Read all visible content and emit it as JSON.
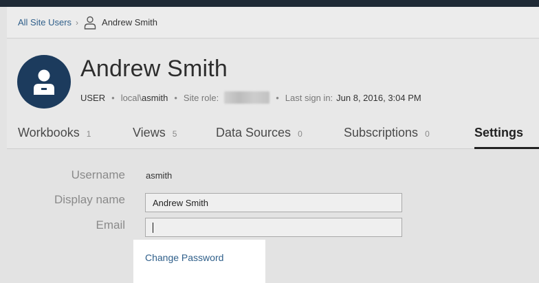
{
  "breadcrumb": {
    "root_label": "All Site Users",
    "separator": "›",
    "current_label": "Andrew Smith"
  },
  "user": {
    "display_name": "Andrew Smith",
    "type_label": "USER",
    "domain_prefix": "local\\",
    "username": "asmith",
    "site_role_label": "Site role:",
    "last_sign_in_label": "Last sign in:",
    "last_sign_in_value": "Jun 8, 2016, 3:04 PM"
  },
  "tabs": [
    {
      "label": "Workbooks",
      "count": "1"
    },
    {
      "label": "Views",
      "count": "5"
    },
    {
      "label": "Data Sources",
      "count": "0"
    },
    {
      "label": "Subscriptions",
      "count": "0"
    },
    {
      "label": "Settings",
      "count": ""
    }
  ],
  "settings": {
    "username_label": "Username",
    "username_value": "asmith",
    "display_name_label": "Display name",
    "display_name_value": "Andrew Smith",
    "email_label": "Email",
    "email_value": "",
    "change_password_label": "Change Password"
  },
  "colors": {
    "avatar_bg": "#1c3b5d",
    "link": "#2f5f8a",
    "active_tab_underline": "#222222"
  },
  "icons": {
    "breadcrumb_user": "person-outline-icon",
    "avatar": "person-icon"
  }
}
